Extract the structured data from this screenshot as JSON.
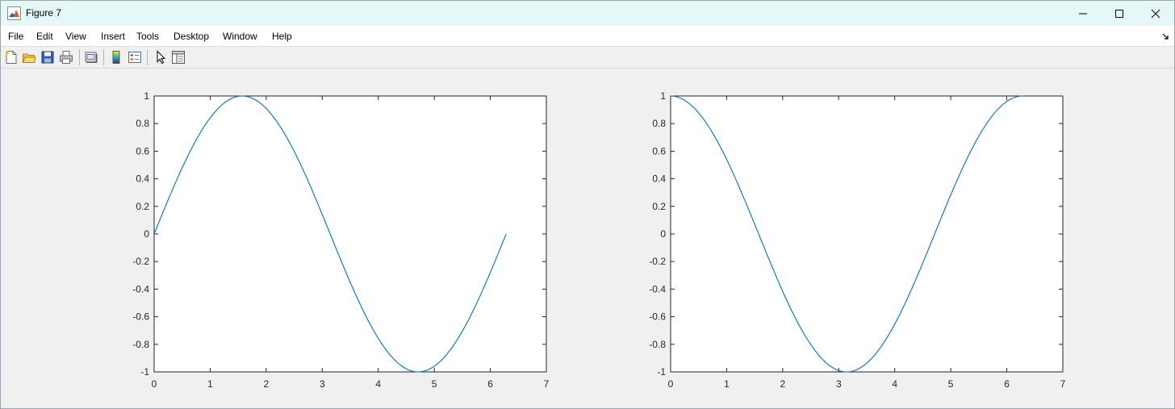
{
  "window": {
    "title": "Figure 7",
    "icon": "matlab-logo-icon",
    "controls": [
      "minimize",
      "maximize",
      "close"
    ]
  },
  "menubar": {
    "items": [
      "File",
      "Edit",
      "View",
      "Insert",
      "Tools",
      "Desktop",
      "Window",
      "Help"
    ]
  },
  "toolbar": {
    "buttons": [
      "new-figure-icon",
      "open-file-icon",
      "save-icon",
      "print-icon",
      "link-plot-icon",
      "insert-colorbar-icon",
      "insert-legend-icon",
      "edit-plot-pointer-icon",
      "property-inspector-icon"
    ]
  },
  "colors": {
    "line": "#0072BD",
    "axes_bg": "#ffffff",
    "figure_bg": "#f0f0f0"
  },
  "chart_data": [
    {
      "type": "line",
      "function": "sin",
      "title": "",
      "xlabel": "",
      "ylabel": "",
      "xlim": [
        0,
        7
      ],
      "ylim": [
        -1,
        1
      ],
      "xticks": [
        "0",
        "1",
        "2",
        "3",
        "4",
        "5",
        "6",
        "7"
      ],
      "yticks": [
        "-1",
        "-0.8",
        "-0.6",
        "-0.4",
        "-0.2",
        "0",
        "0.2",
        "0.4",
        "0.6",
        "0.8",
        "1"
      ],
      "x": [
        0.0,
        0.25,
        0.5,
        0.75,
        1.0,
        1.25,
        1.5,
        1.571,
        1.75,
        2.0,
        2.25,
        2.5,
        2.75,
        3.0,
        3.25,
        3.5,
        3.75,
        4.0,
        4.25,
        4.5,
        4.712,
        4.75,
        5.0,
        5.25,
        5.5,
        5.75,
        6.0,
        6.283
      ],
      "y": [
        0.0,
        0.247,
        0.479,
        0.682,
        0.841,
        0.949,
        0.997,
        1.0,
        0.984,
        0.909,
        0.778,
        0.598,
        0.382,
        0.141,
        -0.108,
        -0.351,
        -0.572,
        -0.757,
        -0.895,
        -0.978,
        -1.0,
        -0.999,
        -0.959,
        -0.859,
        -0.706,
        -0.508,
        -0.279,
        0.0
      ],
      "grid": false
    },
    {
      "type": "line",
      "function": "cos",
      "title": "",
      "xlabel": "",
      "ylabel": "",
      "xlim": [
        0,
        7
      ],
      "ylim": [
        -1,
        1
      ],
      "xticks": [
        "0",
        "1",
        "2",
        "3",
        "4",
        "5",
        "6",
        "7"
      ],
      "yticks": [
        "-1",
        "-0.8",
        "-0.6",
        "-0.4",
        "-0.2",
        "0",
        "0.2",
        "0.4",
        "0.6",
        "0.8",
        "1"
      ],
      "x": [
        0.0,
        0.25,
        0.5,
        0.75,
        1.0,
        1.25,
        1.5,
        1.75,
        2.0,
        2.25,
        2.5,
        2.75,
        3.0,
        3.142,
        3.25,
        3.5,
        3.75,
        4.0,
        4.25,
        4.5,
        4.75,
        5.0,
        5.25,
        5.5,
        5.75,
        6.0,
        6.283
      ],
      "y": [
        1.0,
        0.969,
        0.878,
        0.732,
        0.54,
        0.315,
        0.071,
        -0.178,
        -0.416,
        -0.628,
        -0.801,
        -0.924,
        -0.99,
        -1.0,
        -0.994,
        -0.936,
        -0.82,
        -0.654,
        -0.446,
        -0.211,
        0.038,
        0.284,
        0.512,
        0.709,
        0.861,
        0.96,
        1.0
      ],
      "grid": false
    }
  ]
}
